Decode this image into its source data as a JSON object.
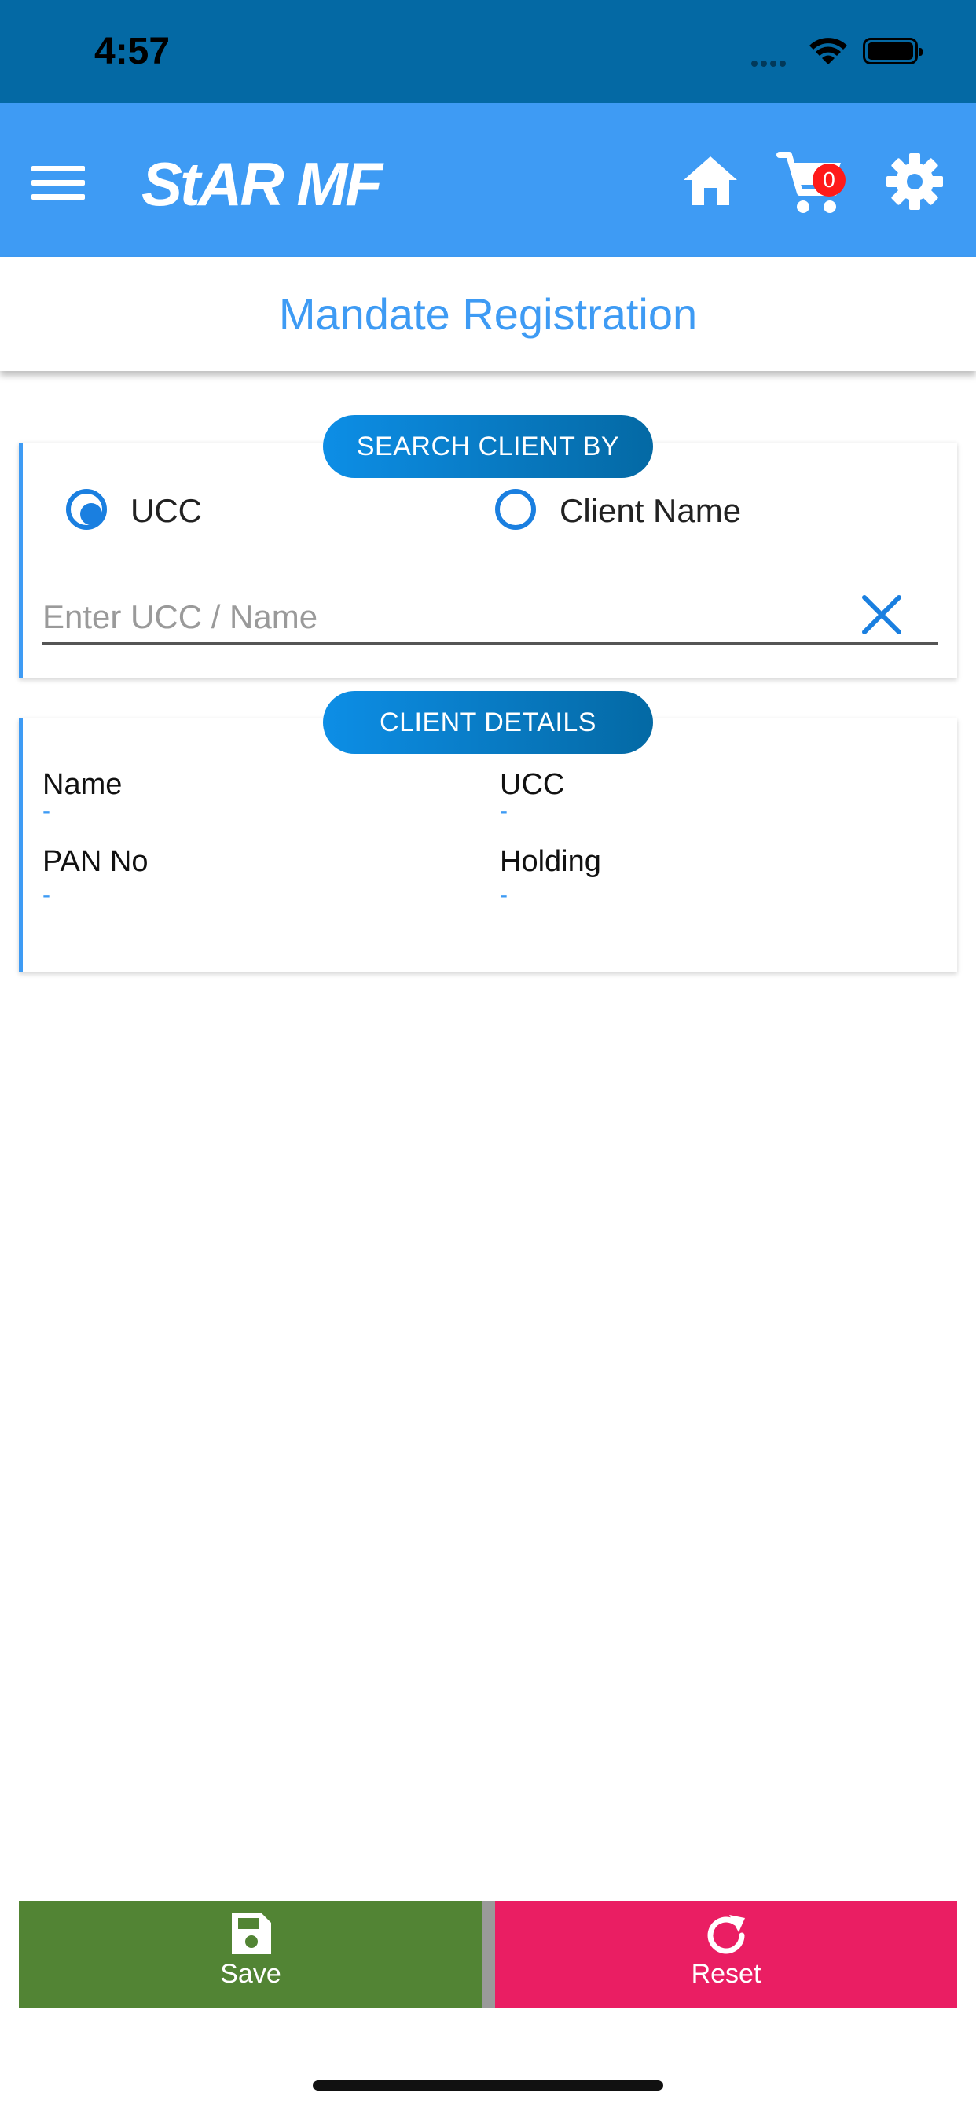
{
  "status_bar": {
    "time": "4:57"
  },
  "app_bar": {
    "logo_text": "StAR MF",
    "cart_count": "0"
  },
  "header": {
    "title": "Mandate Registration"
  },
  "search_section": {
    "heading": "SEARCH CLIENT BY",
    "options": [
      {
        "label": "UCC",
        "selected": true
      },
      {
        "label": "Client Name",
        "selected": false
      }
    ],
    "input": {
      "value": "",
      "placeholder": "Enter UCC / Name"
    }
  },
  "client_details": {
    "heading": "CLIENT DETAILS",
    "fields": [
      {
        "label": "Name",
        "value": "-"
      },
      {
        "label": "UCC",
        "value": "-"
      },
      {
        "label": "PAN No",
        "value": "-"
      },
      {
        "label": "Holding",
        "value": "-"
      }
    ]
  },
  "actions": {
    "save_label": "Save",
    "reset_label": "Reset"
  },
  "colors": {
    "status_bar": "#0469a4",
    "app_bar": "#3e9bf4",
    "save": "#528434",
    "reset": "#ea1e63",
    "badge": "#ff1a1a"
  }
}
